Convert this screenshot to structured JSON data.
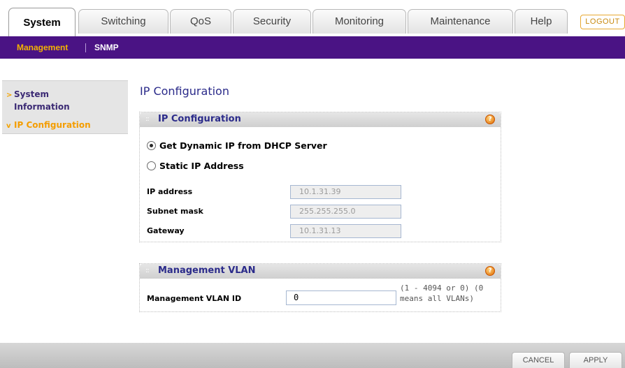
{
  "tabs": [
    {
      "label": "System",
      "active": true
    },
    {
      "label": "Switching",
      "active": false
    },
    {
      "label": "QoS",
      "active": false
    },
    {
      "label": "Security",
      "active": false
    },
    {
      "label": "Monitoring",
      "active": false
    },
    {
      "label": "Maintenance",
      "active": false
    },
    {
      "label": "Help",
      "active": false
    }
  ],
  "logout_label": "LOGOUT",
  "subnav": [
    {
      "label": "Management",
      "active": true
    },
    {
      "label": "SNMP",
      "active": false
    }
  ],
  "sidebar": {
    "items": [
      {
        "label_line1": "System",
        "label_line2": "Information",
        "arrow": ">",
        "active": false
      },
      {
        "label_line1": "IP Configuration",
        "arrow": "v",
        "active": true
      }
    ]
  },
  "page_title": "IP Configuration",
  "ip_panel": {
    "title": "IP Configuration",
    "help": "?",
    "options": [
      {
        "label": "Get Dynamic IP from DHCP Server",
        "selected": true
      },
      {
        "label": "Static IP Address",
        "selected": false
      }
    ],
    "fields": [
      {
        "label": "IP address",
        "value": "10.1.31.39"
      },
      {
        "label": "Subnet mask",
        "value": "255.255.255.0"
      },
      {
        "label": "Gateway",
        "value": "10.1.31.13"
      }
    ]
  },
  "vlan_panel": {
    "title": "Management VLAN",
    "help": "?",
    "field_label": "Management VLAN ID",
    "value": "0",
    "hint_line1": "(1 - 4094 or 0) (0",
    "hint_line2": "means all VLANs)"
  },
  "buttons": {
    "cancel": "CANCEL",
    "apply": "APPLY"
  },
  "colors": {
    "brand_purple": "#4a1384",
    "accent_orange": "#f4a300",
    "title_blue": "#2b2b8a"
  }
}
